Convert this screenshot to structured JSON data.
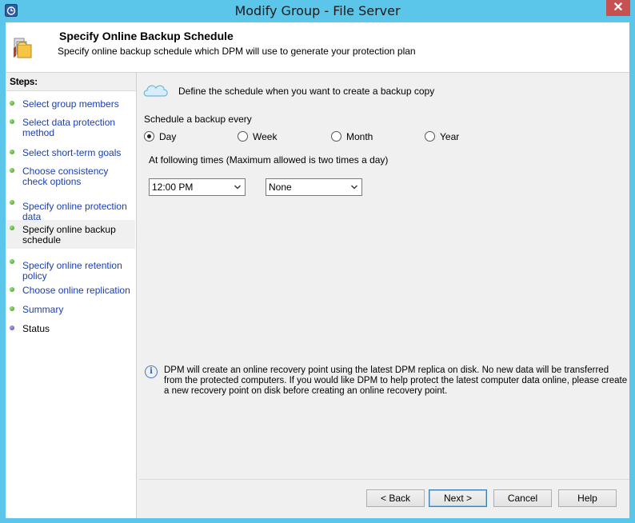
{
  "window": {
    "title": "Modify Group - File Server",
    "close_glyph": "✕"
  },
  "header": {
    "title": "Specify Online Backup Schedule",
    "subtitle": "Specify online backup schedule which DPM will use to generate your protection plan"
  },
  "sidebar": {
    "heading": "Steps:",
    "items": [
      {
        "label": "Select group members",
        "state": "done"
      },
      {
        "label": "Select data protection method",
        "state": "done"
      },
      {
        "label": "Select short-term goals",
        "state": "done"
      },
      {
        "label": "Choose consistency check options",
        "state": "done"
      },
      {
        "label": "Specify online protection data",
        "state": "done"
      },
      {
        "label": "Specify online backup schedule",
        "state": "current"
      },
      {
        "label": "Specify online retention policy",
        "state": "done"
      },
      {
        "label": "Choose online replication",
        "state": "done"
      },
      {
        "label": "Summary",
        "state": "done"
      },
      {
        "label": "Status",
        "state": "pending"
      }
    ]
  },
  "main": {
    "define_text": "Define the schedule when you want to create a backup copy",
    "schedule_label": "Schedule a backup every",
    "frequency_options": [
      {
        "label": "Day",
        "checked": true
      },
      {
        "label": "Week",
        "checked": false
      },
      {
        "label": "Month",
        "checked": false
      },
      {
        "label": "Year",
        "checked": false
      }
    ],
    "times_label": "At following times (Maximum allowed is two times a day)",
    "time1_value": "12:00 PM",
    "time2_value": "None",
    "info_text": "DPM will create an online recovery point using the latest DPM replica on disk. No new data will be transferred from the protected computers. If you would like DPM to help protect the latest computer data online, please create a new recovery point on disk before creating an online recovery point."
  },
  "footer": {
    "back_label": "< Back",
    "next_label": "Next >",
    "cancel_label": "Cancel",
    "help_label": "Help"
  },
  "colors": {
    "titlebar": "#5bc6ea",
    "link": "#1a3fb0",
    "done_dot": "#2f9a1e",
    "pending_dot": "#4a45b8"
  },
  "icons": {
    "app": "dpm-app-icon",
    "header": "protection-group-icon",
    "cloud": "cloud-icon",
    "info": "info-icon"
  }
}
